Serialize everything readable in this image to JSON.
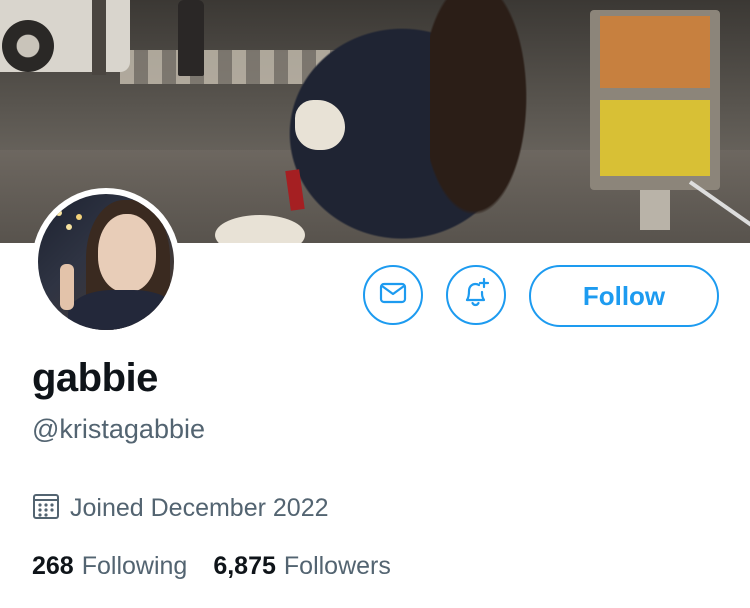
{
  "profile": {
    "display_name": "gabbie",
    "handle": "@kristagabbie",
    "joined": "Joined December 2022"
  },
  "actions": {
    "follow_label": "Follow",
    "message_icon": "envelope-icon",
    "notify_icon": "bell-plus-icon"
  },
  "stats": {
    "following_count": "268",
    "following_label": "Following",
    "followers_count": "6,875",
    "followers_label": "Followers"
  },
  "colors": {
    "accent": "#1d9bf0",
    "secondary_text": "#536471",
    "primary_text": "#0f1419"
  },
  "icons": {
    "calendar": "calendar-icon"
  }
}
